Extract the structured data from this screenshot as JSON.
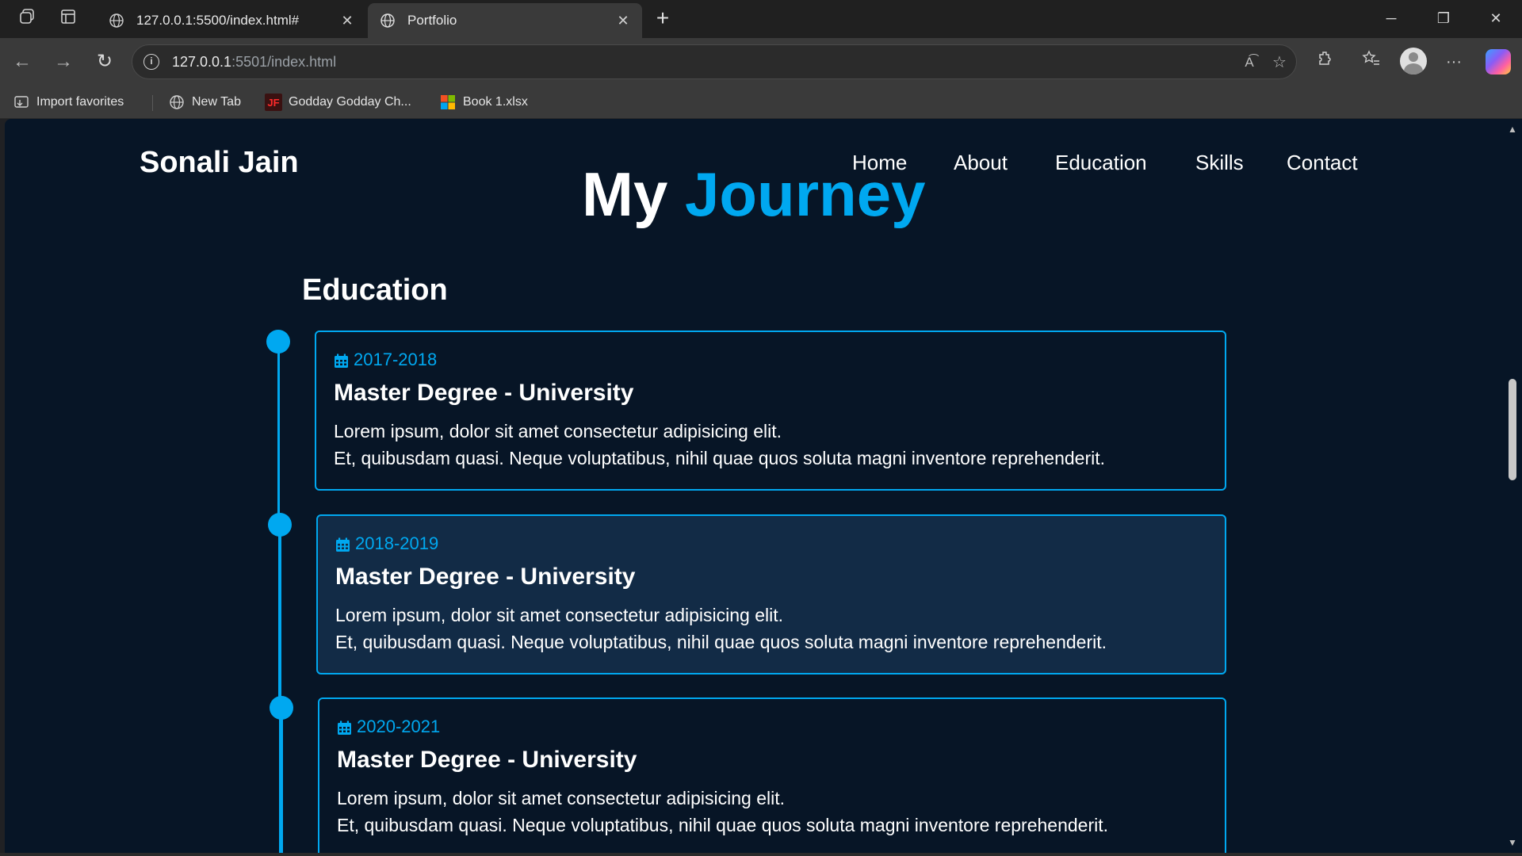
{
  "browser": {
    "tabs": [
      {
        "title": "127.0.0.1:5500/index.html#",
        "active": false
      },
      {
        "title": "Portfolio",
        "active": true
      }
    ],
    "address": {
      "host": "127.0.0.1",
      "rest": ":5501/index.html"
    },
    "bookmarks": [
      {
        "label": "Import favorites",
        "icon": "import-icon"
      },
      {
        "label": "New Tab",
        "icon": "globe-icon"
      },
      {
        "label": "Godday Godday Ch...",
        "icon": "jf-logo-icon"
      },
      {
        "label": "Book 1.xlsx",
        "icon": "microsoft-logo-icon"
      }
    ]
  },
  "site": {
    "brand": "Sonali Jain",
    "nav": [
      "Home",
      "About",
      "Education",
      "Skills",
      "Contact"
    ],
    "title_white": "My",
    "title_accent": "Journey",
    "section": "Education",
    "accent_color": "#00a8f0",
    "background_color": "#071526",
    "entries": [
      {
        "year": "2017-2018",
        "degree": "Master Degree - University",
        "line1": "Lorem ipsum, dolor sit amet consectetur adipisicing elit.",
        "line2": "Et, quibusdam quasi. Neque voluptatibus, nihil quae quos soluta magni inventore reprehenderit."
      },
      {
        "year": "2018-2019",
        "degree": "Master Degree - University",
        "line1": "Lorem ipsum, dolor sit amet consectetur adipisicing elit.",
        "line2": "Et, quibusdam quasi. Neque voluptatibus, nihil quae quos soluta magni inventore reprehenderit."
      },
      {
        "year": "2020-2021",
        "degree": "Master Degree - University",
        "line1": "Lorem ipsum, dolor sit amet consectetur adipisicing elit.",
        "line2": "Et, quibusdam quasi. Neque voluptatibus, nihil quae quos soluta magni inventore reprehenderit."
      }
    ]
  }
}
